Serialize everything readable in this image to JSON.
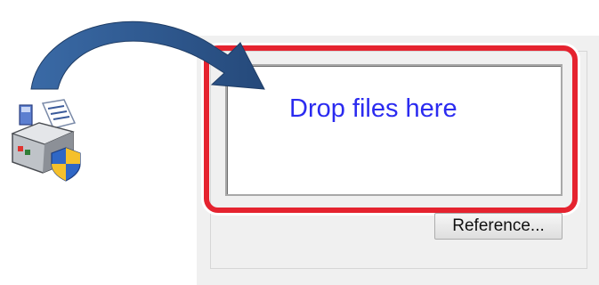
{
  "window": {
    "drop_zone": {
      "label": "Drop files here",
      "text_color": "#2b2bf0"
    },
    "reference_button": {
      "label": "Reference..."
    }
  },
  "annotation": {
    "highlight_color": "#e5232f",
    "arrow_color": "#2f5b93",
    "icon": "printer-with-shield-icon"
  }
}
